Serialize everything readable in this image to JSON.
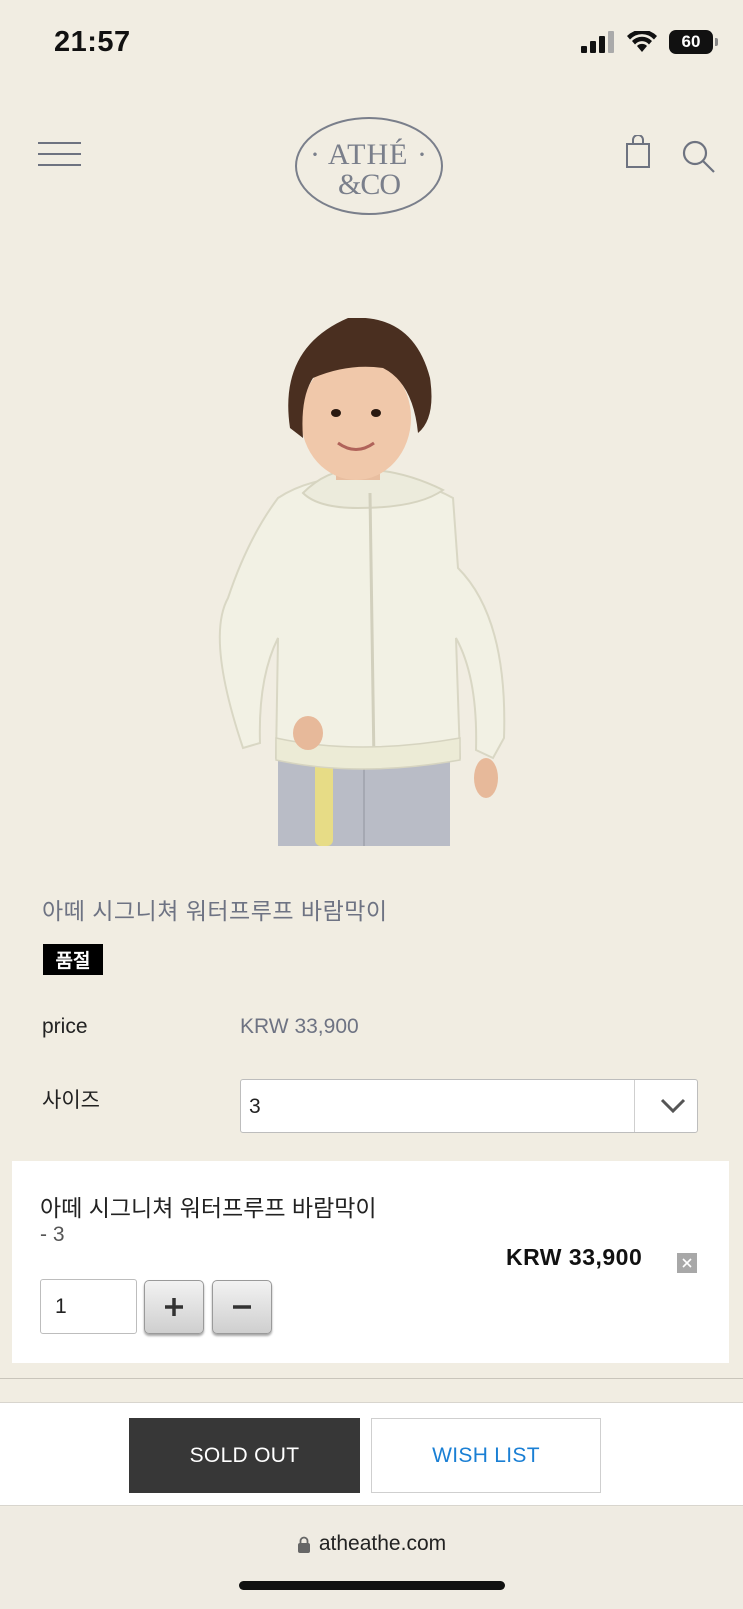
{
  "status_bar": {
    "time": "21:57",
    "battery": "60"
  },
  "header": {
    "logo_line1": "· ATHÉ ·",
    "logo_line2": "&CO"
  },
  "product": {
    "name": "아떼 시그니쳐 워터프루프 바람막이",
    "badge": "품절",
    "price_label": "price",
    "price_value": "KRW 33,900",
    "size_label": "사이즈",
    "size_selected": "3"
  },
  "selected_option": {
    "name": "아떼 시그니쳐 워터프루프 바람막이",
    "size": "- 3",
    "price": "KRW 33,900",
    "quantity": "1"
  },
  "actions": {
    "sold_out_label": "SOLD OUT",
    "wish_list_label": "WISH LIST"
  },
  "browser": {
    "url": "atheathe.com"
  },
  "colors": {
    "background": "#f1ede2",
    "accent_text": "#6e7383",
    "sold_out_button": "#373737",
    "wish_list_text": "#1a7fd4"
  }
}
